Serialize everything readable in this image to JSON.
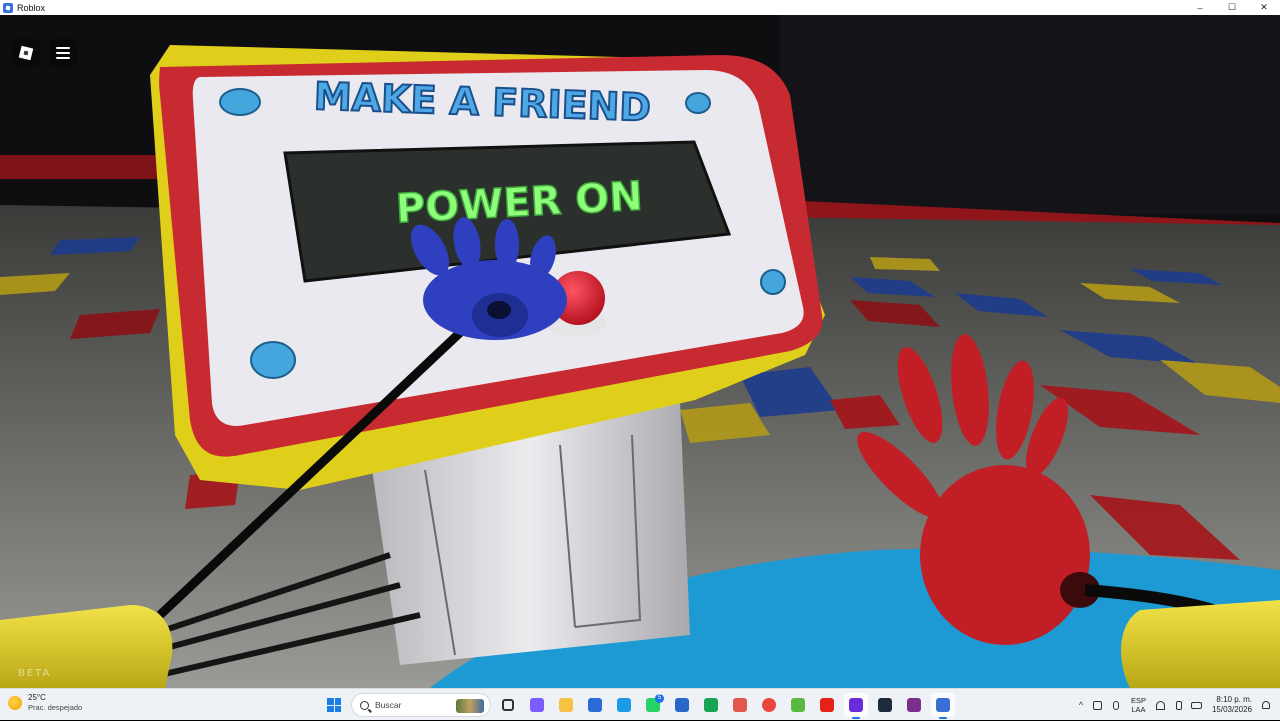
{
  "window": {
    "title": "Roblox",
    "controls": [
      "–",
      "☐",
      "✕"
    ]
  },
  "game": {
    "panel_title": "MAKE A FRIEND",
    "screen_text": "POWER ON",
    "beta_label": "BETA",
    "colors": {
      "panel_red": "#c82a31",
      "panel_yellow": "#e6d21a",
      "screen_green": "#7dff72",
      "hand_blue": "#2b3fb8",
      "hand_red": "#c21e25",
      "button_red": "#e3192c"
    }
  },
  "roblox_ui": {
    "logo_icon": "roblox-logo-icon",
    "menu_icon": "hamburger-menu-icon"
  },
  "taskbar": {
    "weather": {
      "temp": "25°C",
      "desc": "Prac. despejado"
    },
    "search_placeholder": "Buscar",
    "apps": [
      {
        "name": "task-view",
        "color": "#333333"
      },
      {
        "name": "copilot",
        "color": "#7b5cff"
      },
      {
        "name": "file-explorer",
        "color": "#f5c242"
      },
      {
        "name": "store",
        "color": "#2a6bd6"
      },
      {
        "name": "edge",
        "color": "#1a9be6"
      },
      {
        "name": "whatsapp",
        "color": "#25d366",
        "badge": "5"
      },
      {
        "name": "outlook",
        "color": "#2a68c7"
      },
      {
        "name": "excel-green",
        "color": "#19a453"
      },
      {
        "name": "paint",
        "color": "#e2574c"
      },
      {
        "name": "chrome",
        "color": "#e8483c"
      },
      {
        "name": "utorrent",
        "color": "#59b940"
      },
      {
        "name": "youtube",
        "color": "#e62117"
      },
      {
        "name": "vegas",
        "color": "#6a2bd8",
        "active": true
      },
      {
        "name": "capcut",
        "color": "#1d2b3a"
      },
      {
        "name": "winrar",
        "color": "#7a2f8d"
      },
      {
        "name": "roblox",
        "color": "#3a6fd8",
        "active": true
      }
    ],
    "tray": {
      "lang_top": "ESP",
      "lang_bottom": "LAA",
      "time": "8:10 p. m.",
      "date": "15/03/2026"
    }
  }
}
